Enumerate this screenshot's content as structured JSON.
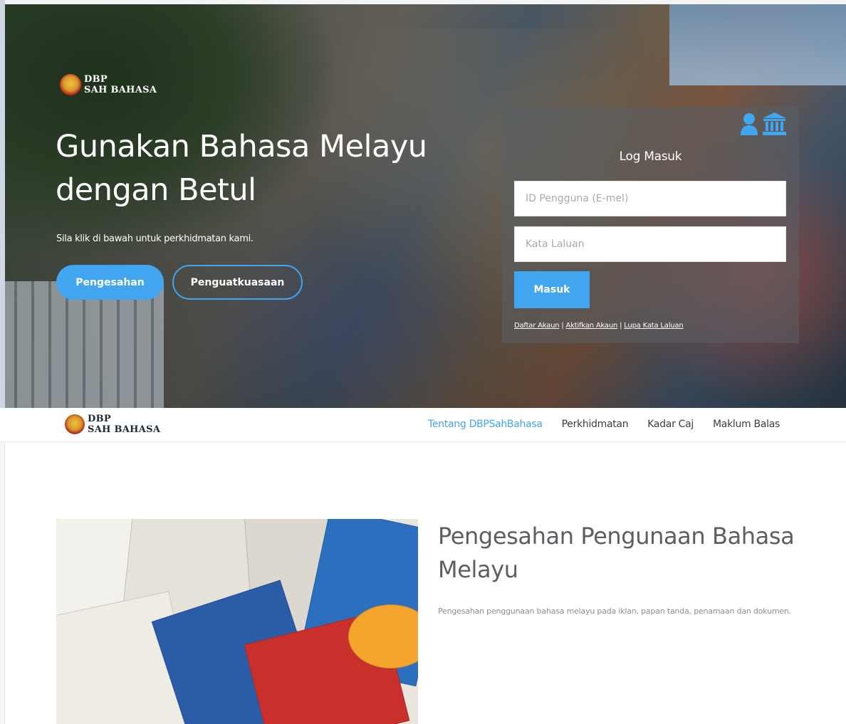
{
  "hero": {
    "brand_line1": "DBP",
    "brand_line2": "SAH BAHASA",
    "title": "Gunakan Bahasa Melayu dengan Betul",
    "subtitle": "Sila klik di bawah untuk perkhidmatan kami.",
    "buttons": {
      "primary": "Pengesahan",
      "secondary": "Penguatkuasaan"
    }
  },
  "login": {
    "title": "Log Masuk",
    "icons": [
      "user-icon",
      "institution-icon"
    ],
    "username_placeholder": "ID Pengguna (E-mel)",
    "password_placeholder": "Kata Laluan",
    "submit_label": "Masuk",
    "links": [
      "Daftar Akaun",
      "Aktifkan Akaun",
      "Lupa Kata Laluan"
    ],
    "separator": "|"
  },
  "navbar": {
    "brand_line1": "DBP",
    "brand_line2": "SAH BAHASA",
    "items": [
      {
        "label": "Tentang DBPSahBahasa",
        "active": true
      },
      {
        "label": "Perkhidmatan",
        "active": false
      },
      {
        "label": "Kadar Caj",
        "active": false
      },
      {
        "label": "Maklum Balas",
        "active": false
      }
    ]
  },
  "section": {
    "title": "Pengesahan Pengunaan Bahasa Melayu",
    "description": "Pengesahan penggunaan bahasa melayu pada iklan, papan tanda, penamaan dan dokumen."
  },
  "colors": {
    "accent": "#42a5f0",
    "nav_text": "#3a3f45",
    "heading_text": "#5b5f63"
  }
}
